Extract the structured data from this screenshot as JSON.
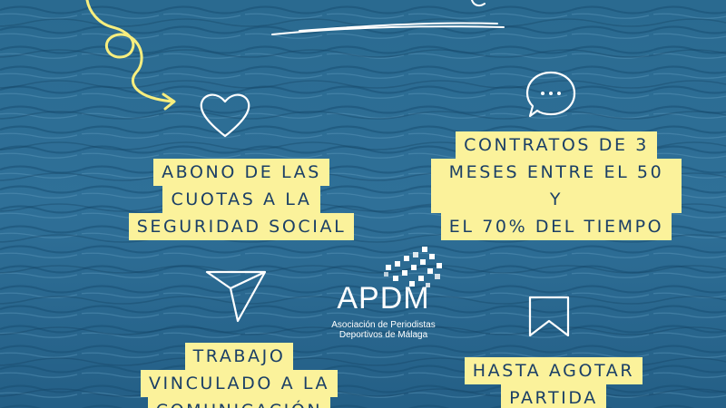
{
  "colors": {
    "sea": "#2f6e93",
    "sea_dark": "#174d6e",
    "label_bg": "#fbf29b",
    "label_text": "#1b3f66",
    "accent_yellow": "#f7ee7e",
    "white": "#ffffff"
  },
  "icons": [
    "curly-arrow-icon",
    "heart-icon",
    "chat-bubble-icon",
    "send-icon",
    "bookmark-icon",
    "swoosh-underline-icon"
  ],
  "benefits": [
    {
      "lines": [
        "ABONO DE LAS",
        "CUOTAS A LA",
        "SEGURIDAD SOCIAL"
      ]
    },
    {
      "lines": [
        "CONTRATOS DE 3",
        "MESES ENTRE EL 50 Y",
        "EL 70% DEL TIEMPO"
      ]
    },
    {
      "lines": [
        "TRABAJO",
        "VINCULADO A LA",
        "COMUNICACIÓN"
      ]
    },
    {
      "lines": [
        "HASTA AGOTAR",
        "PARTIDA"
      ]
    }
  ],
  "logo": {
    "name": "APDM",
    "subtitle_lines": [
      "Asociación de Periodistas",
      "Deportivos de Málaga"
    ]
  }
}
